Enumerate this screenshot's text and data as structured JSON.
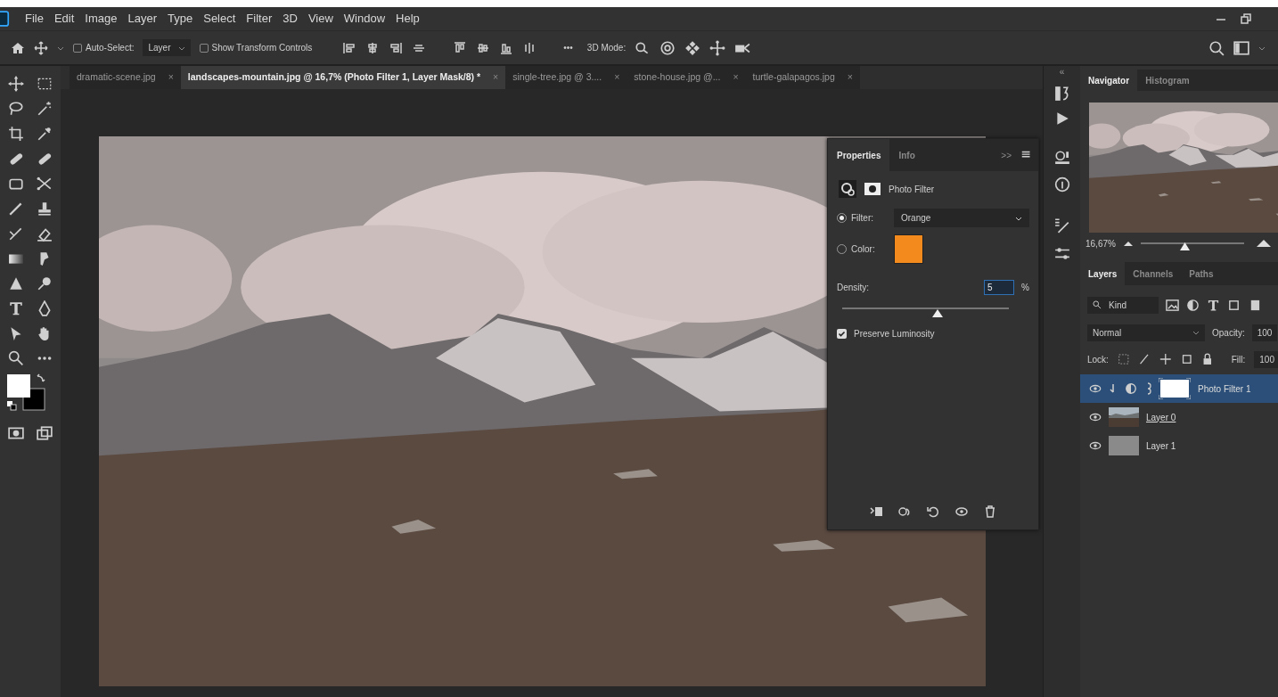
{
  "menu_bar": {
    "items": [
      "File",
      "Edit",
      "Image",
      "Layer",
      "Type",
      "Select",
      "Filter",
      "3D",
      "View",
      "Window",
      "Help"
    ]
  },
  "options_bar": {
    "auto_select": {
      "label": "Auto-Select:",
      "checked": false
    },
    "target": "Layer",
    "transform_controls": {
      "label": "Show Transform Controls",
      "checked": false
    },
    "more": "•••",
    "mode_label": "3D Mode:"
  },
  "document_tabs": [
    {
      "label": "dramatic-scene.jpg",
      "close": "×",
      "selected": false
    },
    {
      "label": "landscapes-mountain.jpg @ 16,7% (Photo Filter 1, Layer Mask/8) *",
      "close": "×",
      "selected": true
    },
    {
      "label": "single-tree.jpg @ 3....",
      "close": "×",
      "selected": false
    },
    {
      "label": "stone-house.jpg @...",
      "close": "×",
      "selected": false
    },
    {
      "label": "turtle-galapagos.jpg",
      "close": "×",
      "selected": false
    }
  ],
  "properties": {
    "tabs": [
      {
        "label": "Properties",
        "selected": true
      },
      {
        "label": "Info",
        "selected": false
      }
    ],
    "expand": ">>",
    "title": "Photo Filter",
    "filter": {
      "label": "Filter:",
      "selected": true,
      "value": "Orange"
    },
    "color": {
      "label": "Color:",
      "selected": false,
      "color": "#f28a1e"
    },
    "density": {
      "label": "Density:",
      "value": "5",
      "unit": "%",
      "level": 0.57
    },
    "preserve_luminosity": {
      "label": "Preserve Luminosity",
      "checked": true
    }
  },
  "navigator": {
    "collapse": "«",
    "tabs": [
      {
        "label": "Navigator",
        "selected": true
      },
      {
        "label": "Histogram",
        "selected": false
      }
    ],
    "zoom": "16,67%"
  },
  "layers": {
    "tabs": [
      {
        "label": "Layers",
        "selected": true
      },
      {
        "label": "Channels",
        "selected": false
      },
      {
        "label": "Paths",
        "selected": false
      }
    ],
    "filter": "Kind",
    "blend_mode": "Normal",
    "opacity_label": "Opacity:",
    "opacity": "100",
    "lock_label": "Lock:",
    "fill_label": "Fill:",
    "fill": "100",
    "items": [
      {
        "name": "Photo Filter 1",
        "kind": "adjustment",
        "selected": true,
        "visible": true,
        "clipped": true,
        "clip_base": false
      },
      {
        "name": "Layer 0",
        "kind": "photo",
        "selected": false,
        "visible": true,
        "clipped": false,
        "clip_base": true
      },
      {
        "name": "Layer 1",
        "kind": "gray",
        "selected": false,
        "visible": true,
        "clipped": false,
        "clip_base": false
      }
    ]
  }
}
